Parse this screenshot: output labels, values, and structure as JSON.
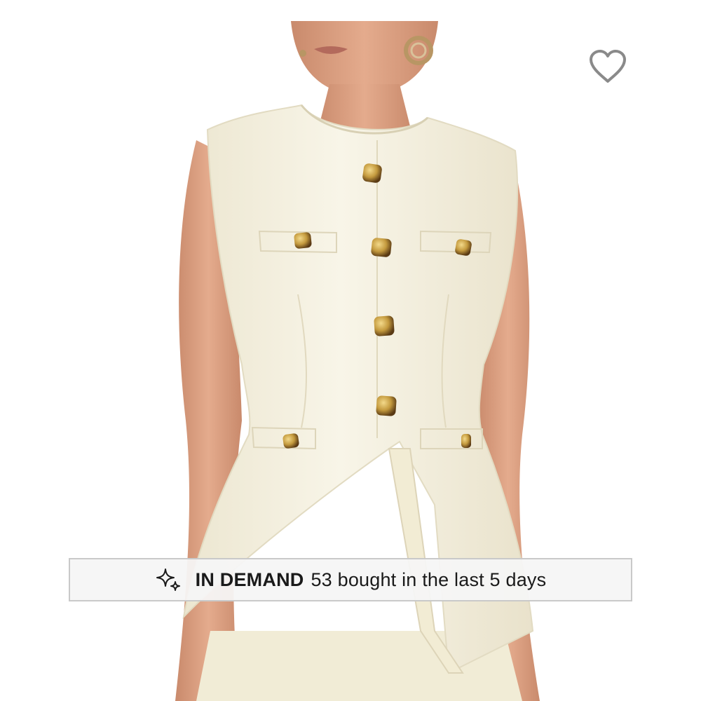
{
  "product": {
    "image_alt": "Woman wearing a cream sleeveless button-front peplum vest with gold buttons"
  },
  "wishlist": {
    "icon": "heart-outline-icon"
  },
  "demand_banner": {
    "icon": "sparkle-icon",
    "label": "IN DEMAND",
    "detail": "53 bought in the last 5 days"
  },
  "colors": {
    "background": "#ffffff",
    "garment": "#f6f2e2",
    "skin": "#e0a486",
    "button_gold": "#c8a24a",
    "banner_bg": "#f5f5f5",
    "banner_border": "#c9c9c9",
    "text": "#1a1a1a",
    "heart": "#8a8a8a"
  }
}
